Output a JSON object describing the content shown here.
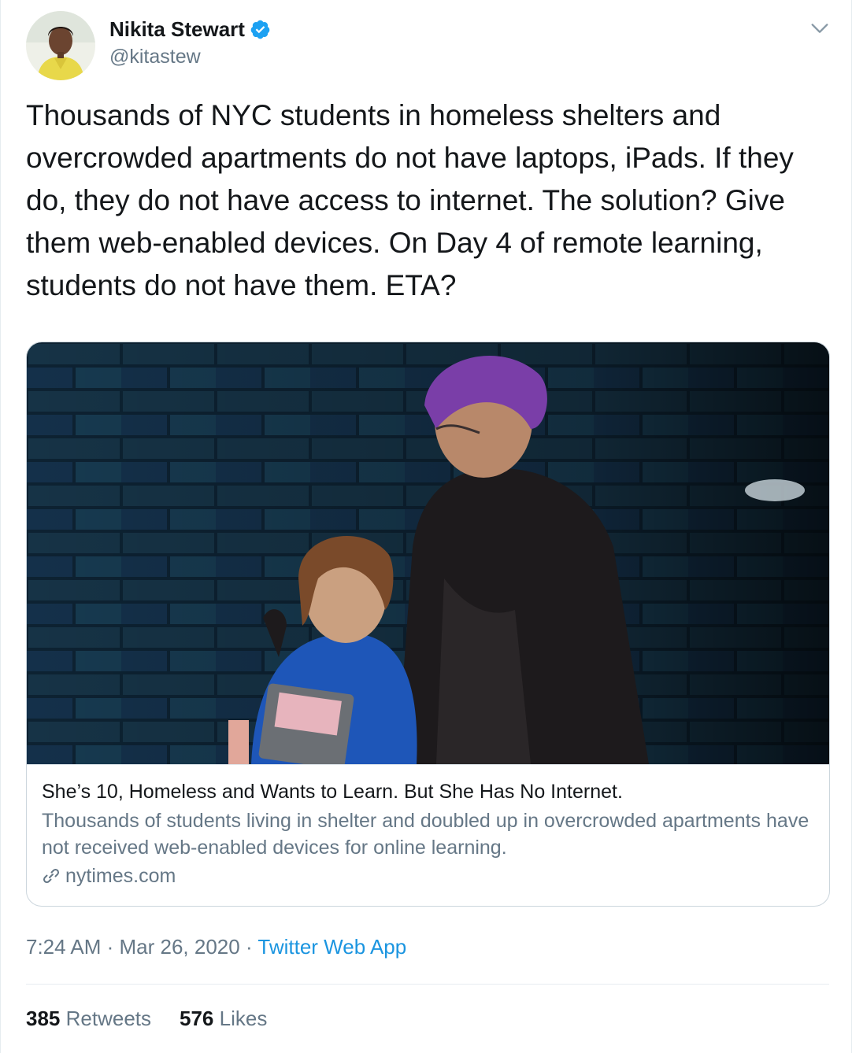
{
  "author": {
    "display_name": "Nikita Stewart",
    "handle": "@kitastew",
    "verified": true,
    "avatar_icon": "profile-photo"
  },
  "tweet": {
    "text": "Thousands of NYC students in homeless shelters and overcrowded apartments do not have laptops, iPads. If they do, they do not have access to internet. The solution? Give them web-enabled devices. On Day 4 of remote learning, students do not have them. ETA?"
  },
  "card": {
    "image_icon": "article-photo",
    "title": "She’s 10, Homeless and Wants to Learn. But She Has No Internet.",
    "description": "Thousands of students living in shelter and doubled up in overcrowded apartments have not received web-enabled devices for online learning.",
    "domain": "nytimes.com"
  },
  "meta": {
    "time": "7:24 AM",
    "separator": " · ",
    "date": "Mar 26, 2020",
    "source": "Twitter Web App"
  },
  "stats": {
    "retweets_count": "385",
    "retweets_label": "Retweets",
    "likes_count": "576",
    "likes_label": "Likes"
  },
  "colors": {
    "link_blue": "#1b95e0",
    "verified_blue": "#1da1f2",
    "secondary_text": "#657786",
    "primary_text": "#14171a"
  }
}
